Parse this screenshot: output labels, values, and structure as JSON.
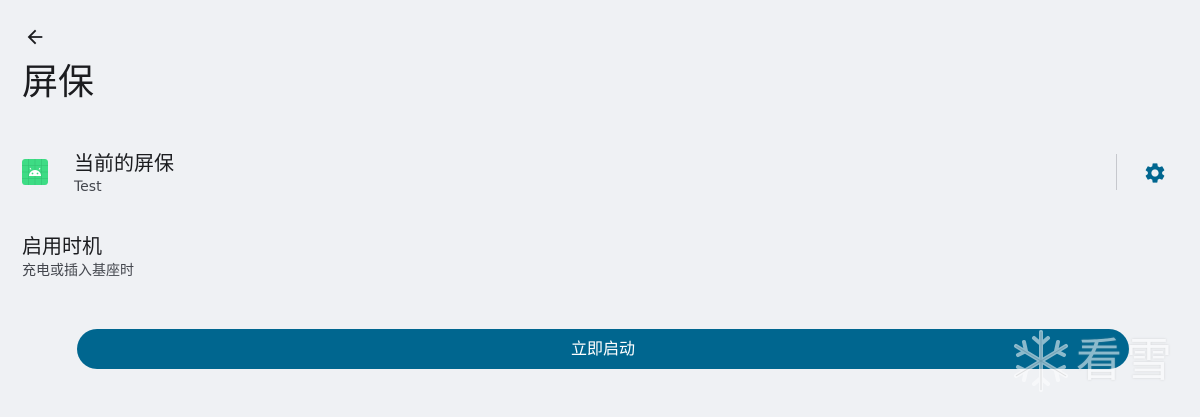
{
  "header": {
    "back_icon": "arrow-back-icon",
    "title": "屏保"
  },
  "current_screensaver": {
    "icon": "android-app-icon",
    "title": "当前的屏保",
    "summary": "Test",
    "settings_icon": "gear-icon"
  },
  "when_to_start": {
    "title": "启用时机",
    "summary": "充电或插入基座时"
  },
  "actions": {
    "start_now_label": "立即启动"
  },
  "watermark": {
    "icon": "snowflake-icon",
    "text": "看雪"
  },
  "colors": {
    "background": "#eff1f4",
    "accent": "#00668f",
    "app_icon_bg": "#3ddc84",
    "text_primary": "#1b1c1f",
    "text_secondary": "#44474e"
  }
}
